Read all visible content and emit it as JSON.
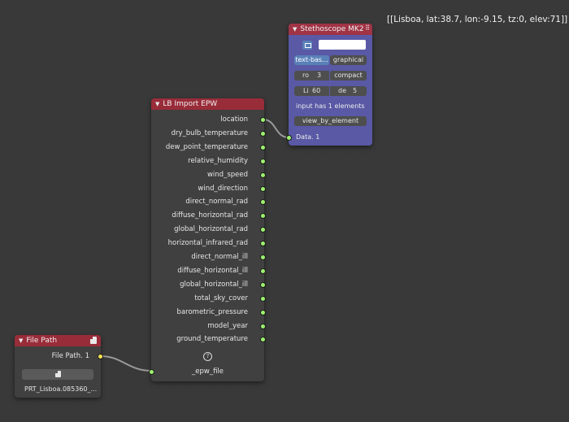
{
  "stethoscope_output": "[[Lisboa, lat:38.7, lon:-9.15, tz:0, elev:71]]",
  "lb_node": {
    "title": "LB Import EPW",
    "outputs": [
      "location",
      "dry_bulb_temperature",
      "dew_point_temperature",
      "relative_humidity",
      "wind_speed",
      "wind_direction",
      "direct_normal_rad",
      "diffuse_horizontal_rad",
      "global_horizontal_rad",
      "horizontal_infrared_rad",
      "direct_normal_ill",
      "diffuse_horizontal_ill",
      "global_horizontal_ill",
      "total_sky_cover",
      "barometric_pressure",
      "model_year",
      "ground_temperature"
    ],
    "input": "_epw_file",
    "help_glyph": "?"
  },
  "file_node": {
    "title": "File Path",
    "output": "File Path. 1",
    "filename": "PRT_Lisboa.085360_..."
  },
  "stethoscope_node": {
    "title": "Stethoscope MK2",
    "mode_text": "text-bas...",
    "mode_graphical": "graphical",
    "ro_label": "ro",
    "ro_value": "3",
    "compact_label": "compact",
    "li_label": "Li",
    "li_value": "60",
    "de_label": "de",
    "de_value": "5",
    "info": "input has 1 elements",
    "view_button": "view_by_element",
    "input": "Data. 1"
  },
  "colors": {
    "socket_data": "#9df26e",
    "socket_path": "#f5e34f",
    "header": "#992c39",
    "stethoscope_body": "#5959a6"
  }
}
